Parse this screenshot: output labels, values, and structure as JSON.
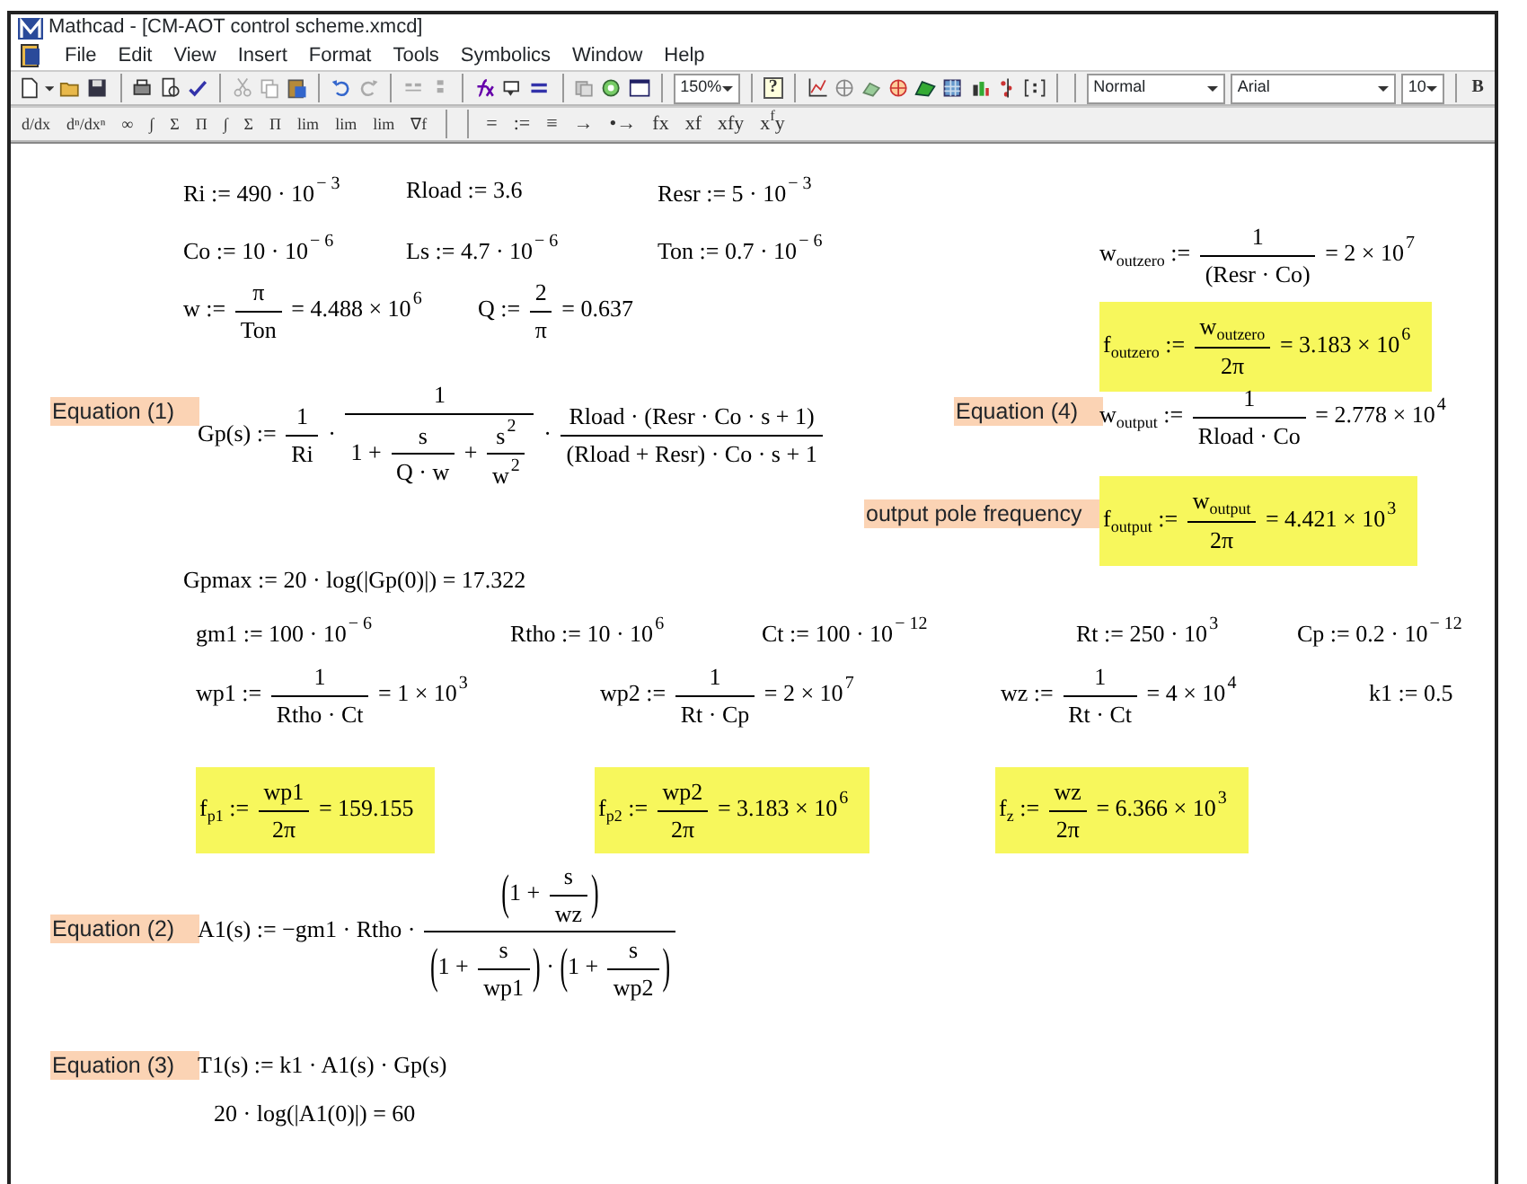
{
  "window": {
    "title": "Mathcad - [CM-AOT control scheme.xmcd]"
  },
  "menu": [
    "File",
    "Edit",
    "View",
    "Insert",
    "Format",
    "Tools",
    "Symbolics",
    "Window",
    "Help"
  ],
  "toolbar": {
    "zoom": "150%",
    "help": "?",
    "style": "Normal",
    "font": "Arial",
    "size": "10",
    "bold": "B"
  },
  "math_toolbar": {
    "calculus": [
      "d/dx",
      "dⁿ/dxⁿ",
      "∞",
      "∫",
      "Σ",
      "Π",
      "∫",
      "Σ",
      "Π",
      "lim",
      "lim",
      "lim",
      "∇f"
    ],
    "evaluation": [
      "=",
      ":=",
      "≡",
      "→",
      "•→",
      "fx",
      "xf",
      "xfy",
      "x$^{f}$y"
    ]
  },
  "worksheet": {
    "regions": [
      {
        "kind": "math",
        "highlighted": false,
        "parts": [
          "Ri := 490 · 10",
          {
            "kind": "sup",
            "text": "− 3"
          }
        ]
      },
      {
        "kind": "math",
        "highlighted": false,
        "parts": [
          "Rload := 3.6"
        ]
      },
      {
        "kind": "math",
        "highlighted": false,
        "parts": [
          "Resr := 5 · 10",
          {
            "kind": "sup",
            "text": "− 3"
          }
        ]
      },
      {
        "kind": "math",
        "highlighted": false,
        "parts": [
          "Co := 10 · 10",
          {
            "kind": "sup",
            "text": "− 6"
          }
        ]
      },
      {
        "kind": "math",
        "highlighted": false,
        "parts": [
          "Ls := 4.7 · 10",
          {
            "kind": "sup",
            "text": "− 6"
          }
        ]
      },
      {
        "kind": "math",
        "highlighted": false,
        "parts": [
          "Ton := 0.7 · 10",
          {
            "kind": "sup",
            "text": "− 6"
          }
        ]
      },
      {
        "kind": "math",
        "highlighted": false,
        "parts": [
          "w := ",
          {
            "kind": "frac",
            "num": [
              "π"
            ],
            "den": [
              "Ton"
            ]
          },
          " = 4.488 × 10",
          {
            "kind": "sup",
            "text": "6"
          }
        ]
      },
      {
        "kind": "math",
        "highlighted": false,
        "parts": [
          "Q := ",
          {
            "kind": "frac",
            "num": [
              "2"
            ],
            "den": [
              "π"
            ]
          },
          " = 0.637"
        ]
      },
      {
        "kind": "math",
        "highlighted": false,
        "parts": [
          "w",
          {
            "kind": "sub",
            "text": "outzero"
          },
          " := ",
          {
            "kind": "frac",
            "num": [
              "1"
            ],
            "den": [
              "(Resr · Co)"
            ]
          },
          " = 2 × 10",
          {
            "kind": "sup",
            "text": "7"
          }
        ]
      },
      {
        "kind": "math",
        "highlighted": true,
        "parts": [
          "f",
          {
            "kind": "sub",
            "text": "outzero"
          },
          " := ",
          {
            "kind": "frac",
            "num": [
              "w",
              {
                "kind": "sub",
                "text": "outzero"
              }
            ],
            "den": [
              "2π"
            ]
          },
          " = 3.183 × 10",
          {
            "kind": "sup",
            "text": "6"
          }
        ]
      },
      {
        "kind": "label",
        "text": "Equation (1)"
      },
      {
        "kind": "math",
        "highlighted": false,
        "parts": [
          "Gp(s) := ",
          {
            "kind": "frac",
            "num": [
              "1"
            ],
            "den": [
              "Ri"
            ]
          },
          " · ",
          {
            "kind": "frac",
            "num": [
              "1"
            ],
            "den": [
              "1 + ",
              {
                "kind": "frac",
                "num": [
                  "s"
                ],
                "den": [
                  "Q · w"
                ]
              },
              " + ",
              {
                "kind": "frac",
                "num": [
                  "s",
                  {
                    "kind": "sup",
                    "text": "2"
                  }
                ],
                "den": [
                  "w",
                  {
                    "kind": "sup",
                    "text": "2"
                  }
                ]
              }
            ]
          },
          " · ",
          {
            "kind": "frac",
            "num": [
              "Rload · (Resr · Co · s + 1)"
            ],
            "den": [
              "(Rload + Resr) · Co · s + 1"
            ]
          }
        ]
      },
      {
        "kind": "label",
        "text": "Equation (4)"
      },
      {
        "kind": "math",
        "highlighted": false,
        "parts": [
          "w",
          {
            "kind": "sub",
            "text": "output"
          },
          " := ",
          {
            "kind": "frac",
            "num": [
              "1"
            ],
            "den": [
              "Rload · Co"
            ]
          },
          " = 2.778 × 10",
          {
            "kind": "sup",
            "text": "4"
          }
        ]
      },
      {
        "kind": "label",
        "text": "output pole frequency"
      },
      {
        "kind": "math",
        "highlighted": true,
        "parts": [
          "f",
          {
            "kind": "sub",
            "text": "output"
          },
          " := ",
          {
            "kind": "frac",
            "num": [
              "w",
              {
                "kind": "sub",
                "text": "output"
              }
            ],
            "den": [
              "2π"
            ]
          },
          " = 4.421 × 10",
          {
            "kind": "sup",
            "text": "3"
          }
        ]
      },
      {
        "kind": "math",
        "highlighted": false,
        "parts": [
          "Gpmax := 20 · log(|Gp(0)|) = 17.322"
        ]
      },
      {
        "kind": "math",
        "highlighted": false,
        "parts": [
          "gm1 := 100 · 10",
          {
            "kind": "sup",
            "text": "− 6"
          }
        ]
      },
      {
        "kind": "math",
        "highlighted": false,
        "parts": [
          "Rtho := 10 · 10",
          {
            "kind": "sup",
            "text": "6"
          }
        ]
      },
      {
        "kind": "math",
        "highlighted": false,
        "parts": [
          "Ct := 100 · 10",
          {
            "kind": "sup",
            "text": "− 12"
          }
        ]
      },
      {
        "kind": "math",
        "highlighted": false,
        "parts": [
          "Rt := 250 · 10",
          {
            "kind": "sup",
            "text": "3"
          }
        ]
      },
      {
        "kind": "math",
        "highlighted": false,
        "parts": [
          "Cp := 0.2 · 10",
          {
            "kind": "sup",
            "text": "− 12"
          }
        ]
      },
      {
        "kind": "math",
        "highlighted": false,
        "parts": [
          "wp1 := ",
          {
            "kind": "frac",
            "num": [
              "1"
            ],
            "den": [
              "Rtho · Ct"
            ]
          },
          " = 1 × 10",
          {
            "kind": "sup",
            "text": "3"
          }
        ]
      },
      {
        "kind": "math",
        "highlighted": false,
        "parts": [
          "wp2 := ",
          {
            "kind": "frac",
            "num": [
              "1"
            ],
            "den": [
              "Rt · Cp"
            ]
          },
          " = 2 × 10",
          {
            "kind": "sup",
            "text": "7"
          }
        ]
      },
      {
        "kind": "math",
        "highlighted": false,
        "parts": [
          "wz := ",
          {
            "kind": "frac",
            "num": [
              "1"
            ],
            "den": [
              "Rt · Ct"
            ]
          },
          " = 4 × 10",
          {
            "kind": "sup",
            "text": "4"
          }
        ]
      },
      {
        "kind": "math",
        "highlighted": false,
        "parts": [
          "k1 := 0.5"
        ]
      },
      {
        "kind": "math",
        "highlighted": true,
        "parts": [
          "f",
          {
            "kind": "sub",
            "text": "p1"
          },
          " := ",
          {
            "kind": "frac",
            "num": [
              "wp1"
            ],
            "den": [
              "2π"
            ]
          },
          " = 159.155"
        ]
      },
      {
        "kind": "math",
        "highlighted": true,
        "parts": [
          "f",
          {
            "kind": "sub",
            "text": "p2"
          },
          " := ",
          {
            "kind": "frac",
            "num": [
              "wp2"
            ],
            "den": [
              "2π"
            ]
          },
          " = 3.183 × 10",
          {
            "kind": "sup",
            "text": "6"
          }
        ]
      },
      {
        "kind": "math",
        "highlighted": true,
        "parts": [
          "f",
          {
            "kind": "sub",
            "text": "z"
          },
          " := ",
          {
            "kind": "frac",
            "num": [
              "wz"
            ],
            "den": [
              "2π"
            ]
          },
          " = 6.366 × 10",
          {
            "kind": "sup",
            "text": "3"
          }
        ]
      },
      {
        "kind": "label",
        "text": "Equation (2)"
      },
      {
        "kind": "math",
        "highlighted": false,
        "parts": [
          "A1(s) := −gm1 · Rtho · ",
          {
            "kind": "frac",
            "num": [
              {
                "kind": "paren",
                "open": "(",
                "close": ")",
                "parts": [
                  "1 + ",
                  {
                    "kind": "frac",
                    "num": [
                      "s"
                    ],
                    "den": [
                      "wz"
                    ]
                  }
                ]
              }
            ],
            "den": [
              {
                "kind": "paren",
                "open": "(",
                "close": ")",
                "parts": [
                  "1 + ",
                  {
                    "kind": "frac",
                    "num": [
                      "s"
                    ],
                    "den": [
                      "wp1"
                    ]
                  }
                ]
              },
              " · ",
              {
                "kind": "paren",
                "open": "(",
                "close": ")",
                "parts": [
                  "1 + ",
                  {
                    "kind": "frac",
                    "num": [
                      "s"
                    ],
                    "den": [
                      "wp2"
                    ]
                  }
                ]
              }
            ]
          }
        ]
      },
      {
        "kind": "label",
        "text": "Equation (3)"
      },
      {
        "kind": "math",
        "highlighted": false,
        "parts": [
          "T1(s) := k1 · A1(s) · Gp(s)"
        ]
      },
      {
        "kind": "math",
        "highlighted": false,
        "parts": [
          "20 · log(|A1(0)|) = 60"
        ]
      }
    ]
  }
}
